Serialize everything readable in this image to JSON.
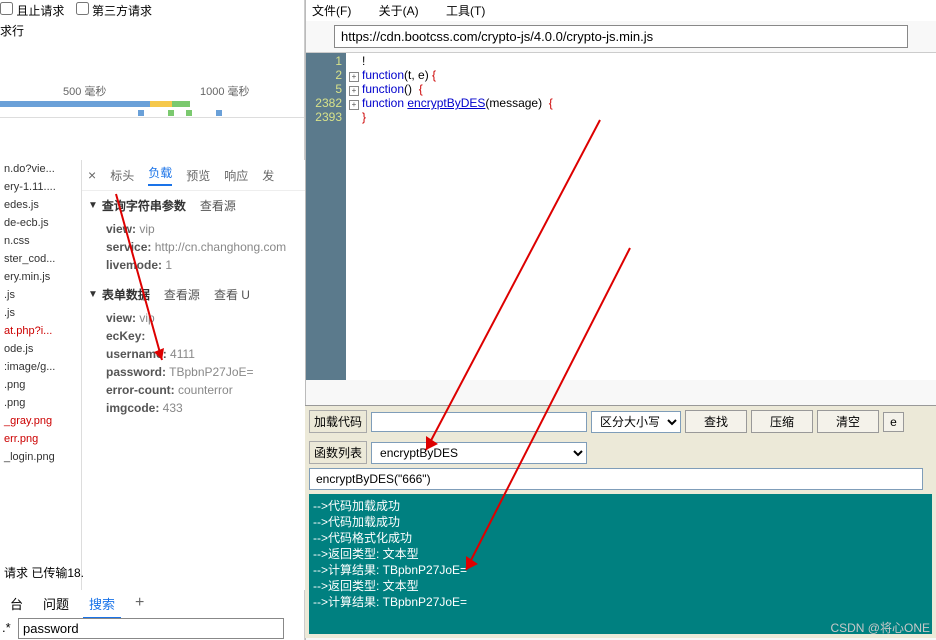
{
  "toolbar": {
    "block_req": "且止请求",
    "third_party": "第三方请求",
    "req_line": "求行"
  },
  "timeline": {
    "t500": "500 毫秒",
    "t1000": "1000 毫秒"
  },
  "files": [
    "n.do?vie...",
    "ery-1.11....",
    "edes.js",
    "de-ecb.js",
    "n.css",
    "ster_cod...",
    "ery.min.js",
    ".js",
    ".js",
    "at.php?i...",
    "ode.js",
    ":image/g...",
    ".png",
    ".png",
    "_gray.png",
    "err.png",
    "_login.png"
  ],
  "status_line": "请求 已传输18.",
  "bottom_tabs": {
    "a": "台",
    "b": "问题",
    "c": "搜索"
  },
  "search_prefix": ".*",
  "search_value": "password",
  "mid_tabs": {
    "headers": "标头",
    "payload": "负载",
    "preview": "预览",
    "response": "响应",
    "more": "发"
  },
  "sec1": {
    "title": "查询字符串参数",
    "view_src": "查看源",
    "kv": [
      [
        "view",
        "vip"
      ],
      [
        "service",
        "http://cn.changhong.com"
      ],
      [
        "livemode",
        "1"
      ]
    ]
  },
  "sec2": {
    "title": "表单数据",
    "view_src": "查看源",
    "view_url": "查看 U",
    "kv": [
      [
        "view",
        "vip"
      ],
      [
        "ecKey",
        ""
      ],
      [
        "username",
        "4111"
      ],
      [
        "password",
        "TBpbnP27JoE="
      ],
      [
        "error-count",
        "counterror"
      ],
      [
        "imgcode",
        "433"
      ]
    ]
  },
  "menubar": {
    "file": "文件(F)",
    "about": "关于(A)",
    "tools": "工具(T)"
  },
  "url": "https://cdn.bootcss.com/crypto-js/4.0.0/crypto-js.min.js",
  "code": {
    "lines": [
      "1",
      "2",
      "5",
      "2382",
      "2393"
    ],
    "rows": [
      {
        "fold": "",
        "text": "!"
      },
      {
        "fold": "+",
        "text": "function(t, e) {"
      },
      {
        "fold": "+",
        "text": "function()  {"
      },
      {
        "fold": "+",
        "text": "function encryptByDES(message)  {"
      },
      {
        "fold": "",
        "text": "}"
      }
    ]
  },
  "tool": {
    "load_code": "加载代码",
    "case": "区分大小写",
    "find": "查找",
    "compress": "压缩",
    "clear": "清空",
    "e": "e",
    "func_list": "函数列表",
    "func_sel": "encryptByDES",
    "expr": "encryptByDES(\"666\")"
  },
  "console_lines": [
    "-->代码加载成功",
    "-->代码加载成功",
    "-->代码格式化成功",
    "-->返回类型: 文本型",
    "-->计算结果: TBpbnP27JoE=",
    "-->返回类型: 文本型",
    "-->计算结果: TBpbnP27JoE="
  ],
  "watermark": "CSDN @将心ONE"
}
